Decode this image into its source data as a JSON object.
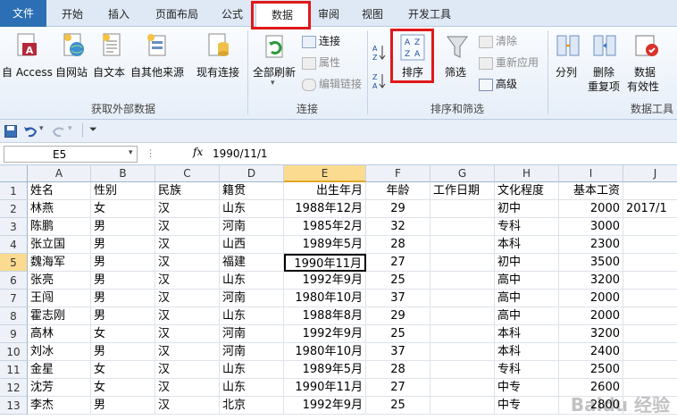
{
  "tabs": {
    "file": "文件",
    "home": "开始",
    "insert": "插入",
    "layout": "页面布局",
    "formulas": "公式",
    "data": "数据",
    "review": "审阅",
    "view": "视图",
    "developer": "开发工具"
  },
  "ribbon": {
    "external": {
      "access": "自 Access",
      "web": "自网站",
      "text": "自文本",
      "other": "自其他来源",
      "existing": "现有连接",
      "group": "获取外部数据"
    },
    "connections": {
      "refresh": "全部刷新",
      "connections": "连接",
      "properties": "属性",
      "edit_links": "编辑链接",
      "group": "连接"
    },
    "sort_filter": {
      "sort": "排序",
      "filter": "筛选",
      "clear": "清除",
      "reapply": "重新应用",
      "advanced": "高级",
      "group": "排序和筛选"
    },
    "tools": {
      "text_to_columns": "分列",
      "remove_dup_1": "删除",
      "remove_dup_2": "重复项",
      "validation_1": "数据",
      "validation_2": "有效性",
      "group": "数据工具"
    }
  },
  "formula_bar": {
    "name_box": "E5",
    "fx": "fx",
    "value": "1990/11/1"
  },
  "columns": [
    "A",
    "B",
    "C",
    "D",
    "E",
    "F",
    "G",
    "H",
    "I",
    "J"
  ],
  "rows": [
    [
      "姓名",
      "性别",
      "民族",
      "籍贯",
      "出生年月",
      "年龄",
      "工作日期",
      "文化程度",
      "基本工资",
      ""
    ],
    [
      "林燕",
      "女",
      "汉",
      "山东",
      "1988年12月",
      "29",
      "",
      "初中",
      "2000",
      "2017/1"
    ],
    [
      "陈鹏",
      "男",
      "汉",
      "河南",
      "1985年2月",
      "32",
      "",
      "专科",
      "3000",
      ""
    ],
    [
      "张立国",
      "男",
      "汉",
      "山西",
      "1989年5月",
      "28",
      "",
      "本科",
      "2300",
      ""
    ],
    [
      "魏海军",
      "男",
      "汉",
      "福建",
      "1990年11月",
      "27",
      "",
      "初中",
      "3500",
      ""
    ],
    [
      "张亮",
      "男",
      "汉",
      "山东",
      "1992年9月",
      "25",
      "",
      "高中",
      "3200",
      ""
    ],
    [
      "王闯",
      "男",
      "汉",
      "河南",
      "1980年10月",
      "37",
      "",
      "高中",
      "2000",
      ""
    ],
    [
      "霍志刚",
      "男",
      "汉",
      "山东",
      "1988年8月",
      "29",
      "",
      "高中",
      "2000",
      ""
    ],
    [
      "高林",
      "女",
      "汉",
      "河南",
      "1992年9月",
      "25",
      "",
      "本科",
      "3200",
      ""
    ],
    [
      "刘冰",
      "男",
      "汉",
      "河南",
      "1980年10月",
      "37",
      "",
      "本科",
      "2400",
      ""
    ],
    [
      "金星",
      "女",
      "汉",
      "山东",
      "1989年5月",
      "28",
      "",
      "专科",
      "2500",
      ""
    ],
    [
      "沈芳",
      "女",
      "汉",
      "山东",
      "1990年11月",
      "27",
      "",
      "中专",
      "2600",
      ""
    ],
    [
      "李杰",
      "男",
      "汉",
      "北京",
      "1992年9月",
      "25",
      "",
      "中专",
      "2800",
      ""
    ]
  ],
  "watermark": "Baidu 经验"
}
